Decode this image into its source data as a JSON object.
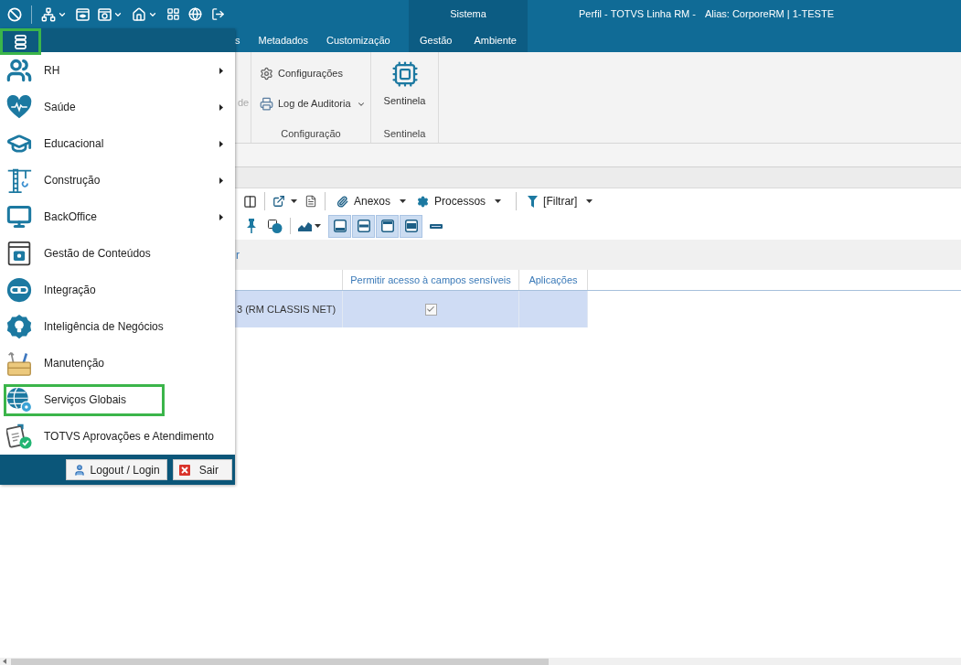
{
  "title_bar": {
    "context_group": "Sistema",
    "title": "Perfil - TOTVS Linha RM -",
    "alias": "Alias: CorporeRM | 1-TESTE"
  },
  "tabs": [
    {
      "label": "s",
      "selected": false,
      "context": false
    },
    {
      "label": "Metadados",
      "selected": false,
      "context": false
    },
    {
      "label": "Customização",
      "selected": false,
      "context": false
    },
    {
      "label": "Gestão",
      "selected": false,
      "context": true
    },
    {
      "label": "Ambiente",
      "selected": false,
      "context": true
    }
  ],
  "ribbon": {
    "partial_group": {
      "text": "de",
      "disabled": true
    },
    "groups": [
      {
        "label": "Configuração",
        "items": [
          {
            "kind": "small",
            "label": "Configurações",
            "has_dropdown": false
          },
          {
            "kind": "small",
            "label": "Log de Auditoria",
            "has_dropdown": true
          }
        ]
      },
      {
        "label": "Sentinela",
        "items": [
          {
            "kind": "large",
            "label": "Sentinela",
            "has_dropdown": false
          }
        ]
      }
    ]
  },
  "toolbar": {
    "actions": [
      {
        "kind": "attachments",
        "label": "Anexos",
        "has_dropdown": true
      },
      {
        "kind": "processes",
        "label": "Processos",
        "has_dropdown": true
      },
      {
        "kind": "filter",
        "label": "[Filtrar]",
        "has_dropdown": true
      }
    ],
    "layout_toggles": [
      {
        "selected": true
      },
      {
        "selected": true
      },
      {
        "selected": true
      },
      {
        "selected": true
      }
    ]
  },
  "filter_bar": {
    "link": "r"
  },
  "table": {
    "columns": [
      {
        "kind": "unlabeled"
      },
      {
        "kind": "labeled",
        "label": "Permitir acesso à campos sensíveis"
      },
      {
        "kind": "labeled",
        "label": "Aplicações"
      }
    ],
    "rows": [
      {
        "selected": true,
        "cells": [
          {
            "kind": "text",
            "text": "3 (RM CLASSIS NET)"
          },
          {
            "kind": "check",
            "checked": true
          },
          {
            "kind": "empty"
          }
        ]
      }
    ]
  },
  "app_menu": {
    "button": {
      "highlighted": true
    },
    "items": [
      {
        "kind": "hr",
        "label": "RH",
        "has_submenu": true,
        "highlighted": false
      },
      {
        "kind": "health",
        "label": "Saúde",
        "has_submenu": true,
        "highlighted": false
      },
      {
        "kind": "education",
        "label": "Educacional",
        "has_submenu": true,
        "highlighted": false
      },
      {
        "kind": "construction",
        "label": "Construção",
        "has_submenu": true,
        "highlighted": false
      },
      {
        "kind": "backoffice",
        "label": "BackOffice",
        "has_submenu": true,
        "highlighted": false
      },
      {
        "kind": "content",
        "label": "Gestão de Conteúdos",
        "has_submenu": false,
        "highlighted": false
      },
      {
        "kind": "integration",
        "label": "Integração",
        "has_submenu": false,
        "highlighted": false
      },
      {
        "kind": "bi",
        "label": "Inteligência de Negócios",
        "has_submenu": false,
        "highlighted": false
      },
      {
        "kind": "maintenance",
        "label": "Manutenção",
        "has_submenu": false,
        "highlighted": false
      },
      {
        "kind": "global",
        "label": "Serviços Globais",
        "has_submenu": false,
        "highlighted": true
      },
      {
        "kind": "approvals",
        "label": "TOTVS Aprovações e Atendimento",
        "has_submenu": false,
        "highlighted": false
      }
    ],
    "footer_buttons": [
      {
        "kind": "logout",
        "label": "Logout / Login"
      },
      {
        "kind": "exit",
        "label": "Sair"
      }
    ]
  }
}
